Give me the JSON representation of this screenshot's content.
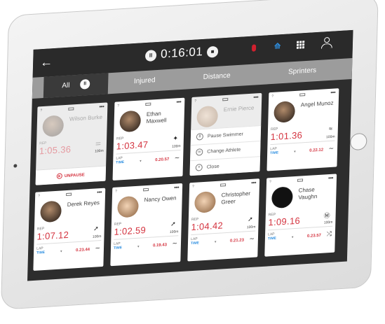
{
  "header": {
    "back_icon": "back-arrow-icon",
    "timer": "0:16:01",
    "pause_glyph": "II",
    "stop_glyph": "■",
    "icons": [
      "microphone-icon",
      "bluetooth-icon",
      "grid-icon",
      "user-icon"
    ],
    "colors": {
      "mic": "#d0202e",
      "bluetooth": "#2e8fe0"
    }
  },
  "tabs": [
    {
      "label": "All",
      "active": true
    },
    {
      "label": "Injured"
    },
    {
      "label": "Distance"
    },
    {
      "label": "Sprinters"
    }
  ],
  "all_tab_pause_glyph": "II",
  "swimmers": [
    {
      "name": "Wilson Burke",
      "rep_label": "REP",
      "rep_time": "1:05.36",
      "distance": "100m",
      "paused": true,
      "action": "UNPAUSE"
    },
    {
      "name": "Ethan Maxwell",
      "rep_label": "REP",
      "rep_time": "1:03.47",
      "distance": "100m",
      "lap_label": "LAP",
      "lap_type": "TIME",
      "lap_time": "0.20.57"
    },
    {
      "name": "Ernie Pierce",
      "menu": [
        "Pause Swimmer",
        "Change Athlete",
        "Close"
      ]
    },
    {
      "name": "Angel Munoz",
      "rep_label": "REP",
      "rep_time": "1:01.36",
      "distance": "100m",
      "lap_label": "LAP",
      "lap_type": "TIME",
      "lap_time": "0.22.12"
    },
    {
      "name": "Derek Reyes",
      "rep_label": "REP",
      "rep_time": "1:07.12",
      "distance": "100m",
      "lap_label": "LAP",
      "lap_type": "TIME",
      "lap_time": "0.23.44"
    },
    {
      "name": "Nancy Owen",
      "rep_label": "REP",
      "rep_time": "1:02.59",
      "distance": "100m",
      "lap_label": "LAP",
      "lap_type": "TIME",
      "lap_time": "0.19.43"
    },
    {
      "name": "Christopher Greer",
      "rep_label": "REP",
      "rep_time": "1:04.42",
      "distance": "100m",
      "lap_label": "LAP",
      "lap_type": "TIME",
      "lap_time": "0.21.23"
    },
    {
      "name": "Chase Vaughn",
      "rep_label": "REP",
      "rep_time": "1:09.16",
      "distance": "100m",
      "lap_label": "LAP",
      "lap_type": "TIME",
      "lap_time": "0.23.57"
    }
  ],
  "card_glyphs": {
    "more": "•••",
    "caret": "▾",
    "status": "?"
  }
}
